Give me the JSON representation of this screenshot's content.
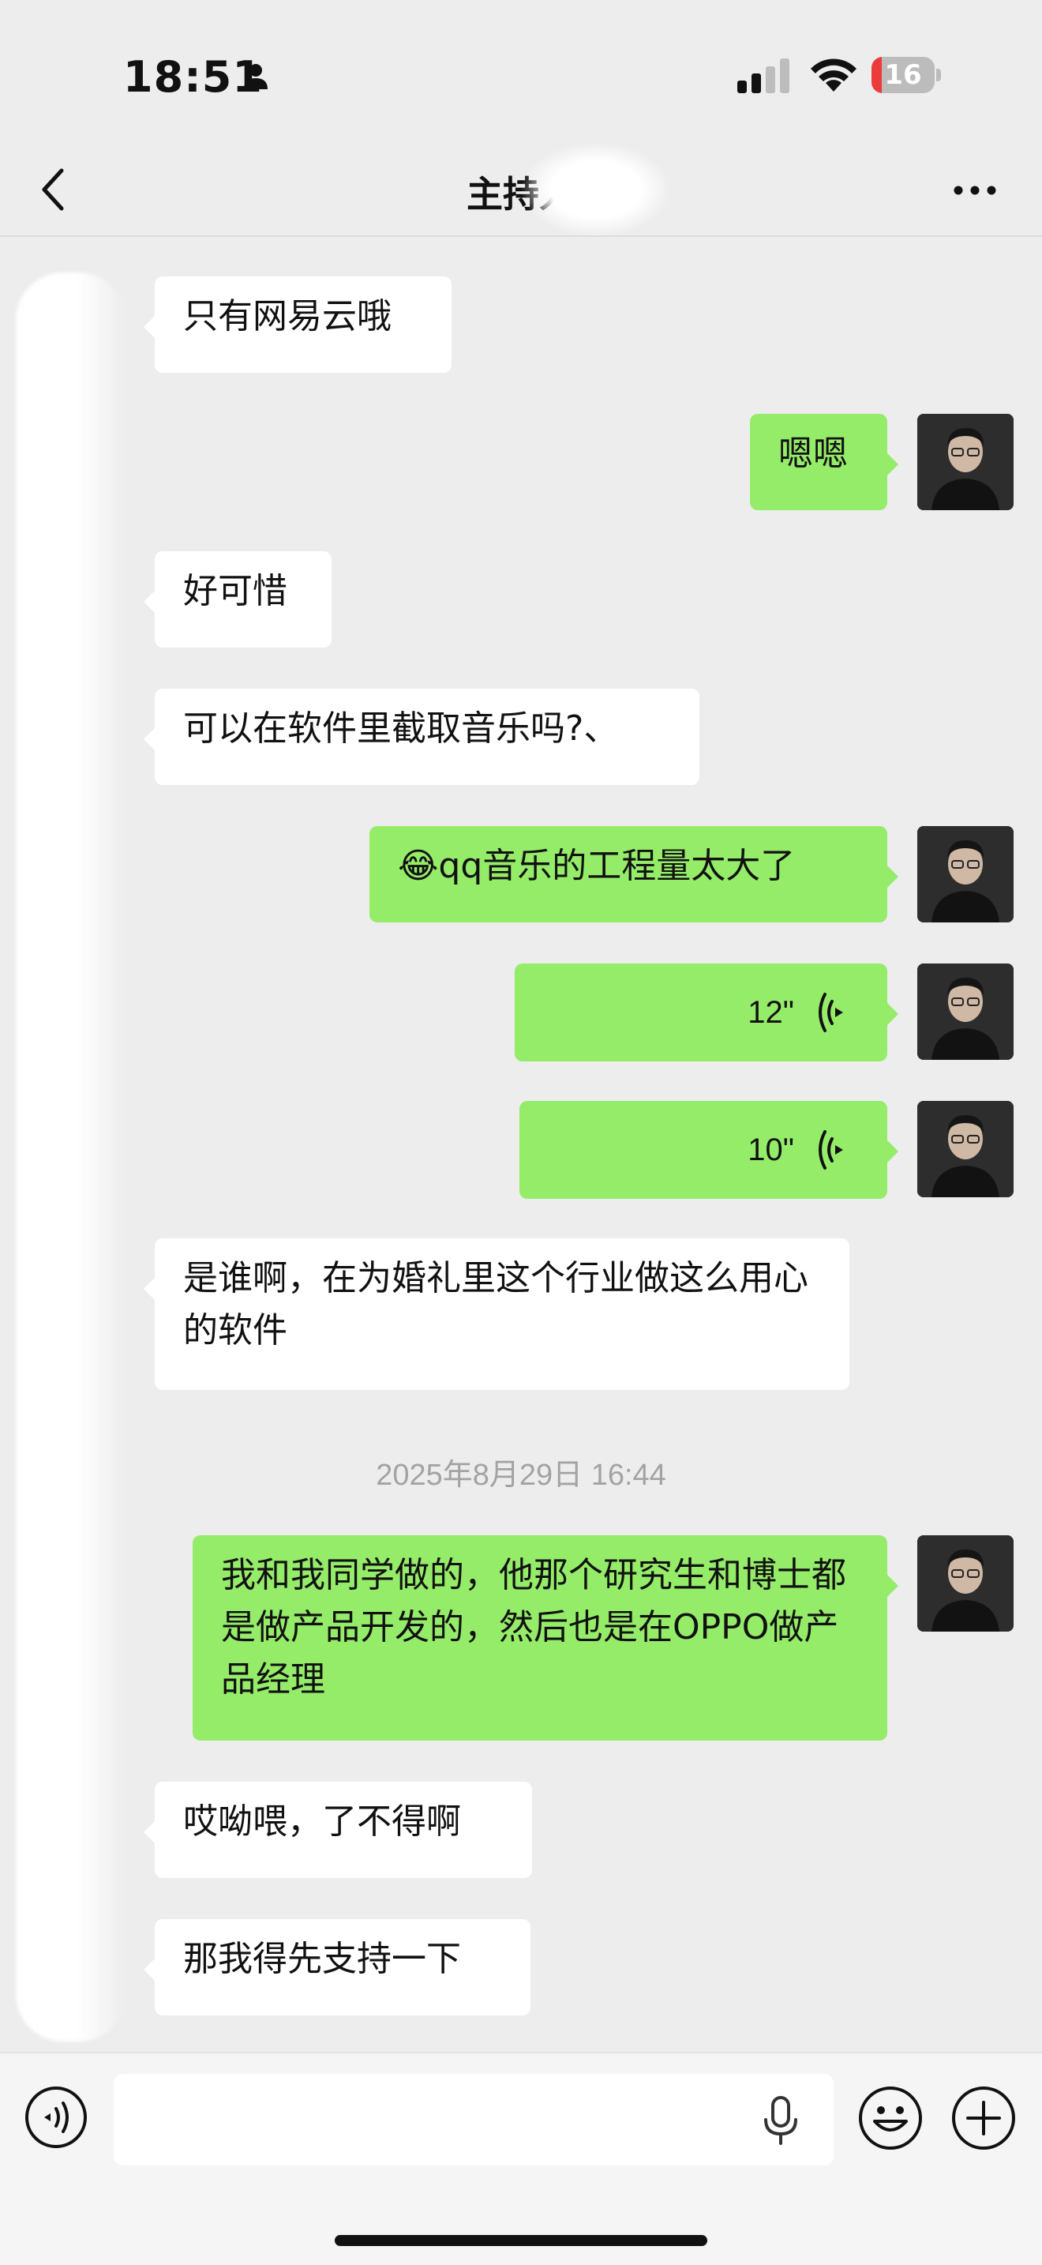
{
  "status_bar": {
    "time": "18:51",
    "battery_level": "16",
    "battery_fill_fraction": 0.16,
    "icons": [
      "person-icon",
      "cellular-signal-icon",
      "wifi-icon",
      "battery-icon"
    ]
  },
  "nav": {
    "title": "主持人",
    "back_icon": "chevron-left-icon",
    "more_icon": "more-dots-icon"
  },
  "messages": [
    {
      "side": "in",
      "text": "只有网易云哦"
    },
    {
      "side": "out",
      "text": "嗯嗯"
    },
    {
      "side": "in",
      "text": "好可惜"
    },
    {
      "side": "in",
      "text": "可以在软件里截取音乐吗?、"
    },
    {
      "side": "out",
      "text": "😂qq音乐的工程量太大了"
    },
    {
      "side": "out",
      "type": "voice",
      "duration": "12\""
    },
    {
      "side": "out",
      "type": "voice",
      "duration": "10\""
    },
    {
      "side": "in",
      "text": "是谁啊，在为婚礼里这个行业做这么用心的软件"
    },
    {
      "side": "out",
      "text": "我和我同学做的，他那个研究生和博士都是做产品开发的，然后也是在OPPO做产品经理"
    },
    {
      "side": "in",
      "text": "哎呦喂，了不得啊"
    },
    {
      "side": "in",
      "text": "那我得先支持一下"
    }
  ],
  "timestamp": "2025年8月29日 16:44",
  "input_bar": {
    "placeholder": "",
    "icons": [
      "voice-mode-icon",
      "microphone-icon",
      "emoji-icon",
      "plus-icon"
    ]
  },
  "colors": {
    "background": "#ededed",
    "outgoing_bubble": "#95ec69",
    "incoming_bubble": "#ffffff",
    "battery_low": "#ec3b3b"
  }
}
